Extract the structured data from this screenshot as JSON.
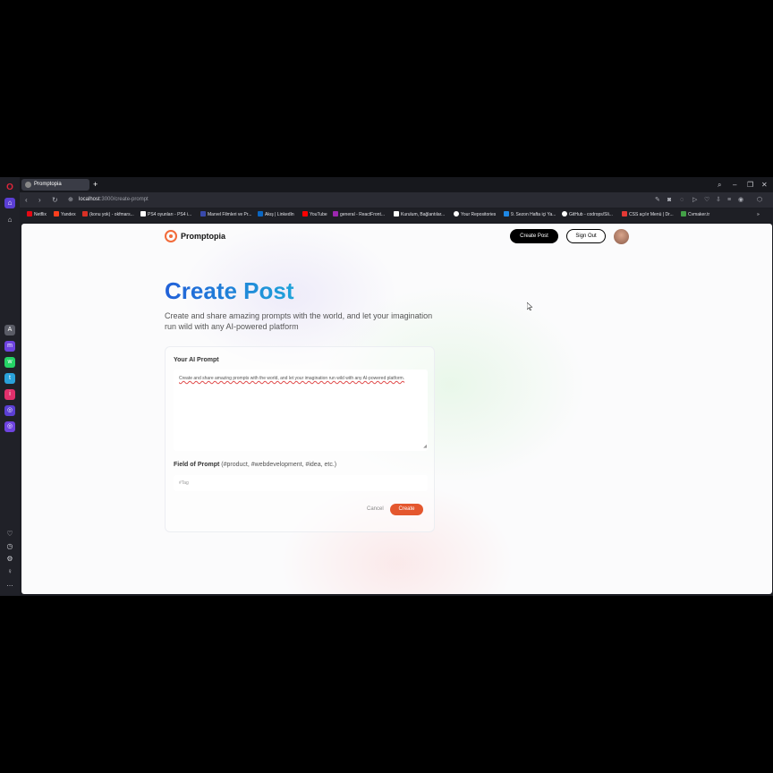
{
  "browser": {
    "tab_title": "Promptopia",
    "new_tab": "+",
    "url_host": "localhost",
    "url_path": ":3000/create-prompt",
    "bookmarks": [
      {
        "label": "Netflix",
        "color": "#e50914"
      },
      {
        "label": "Yandex",
        "color": "#fc3f1d"
      },
      {
        "label": "(konu yok) - okfmars...",
        "color": "#d93025"
      },
      {
        "label": "PS4 oyunları - PS4 i...",
        "color": "#ffffff"
      },
      {
        "label": "Marvel Filmleri ve Pr...",
        "color": "#3949ab"
      },
      {
        "label": "Akış | LinkedIn",
        "color": "#0a66c2"
      },
      {
        "label": "YouTube",
        "color": "#ff0000"
      },
      {
        "label": "general - ReactFront...",
        "color": "#9c27b0"
      },
      {
        "label": "Kurulum, Bağlantılar...",
        "color": "#ffffff"
      },
      {
        "label": "Your Repositories",
        "color": "#ffffff"
      },
      {
        "label": "9. Sezon Hafta içi Ya...",
        "color": "#1e88e5"
      },
      {
        "label": "GitHub - codrops/Sli...",
        "color": "#ffffff"
      },
      {
        "label": "CSS açılır Menü | Dr...",
        "color": "#e53935"
      },
      {
        "label": "Cvmaker.tr",
        "color": "#43a047"
      }
    ]
  },
  "app": {
    "brand": "Promptopia",
    "create_post_button": "Create Post",
    "sign_out_button": "Sign Out",
    "heading": "Create Post",
    "description": "Create and share amazing prompts with the world, and let your imagination run wild with any AI-powered platform",
    "prompt_label": "Your AI Prompt",
    "prompt_value": "Create and share amazing prompts with the world, and let your imagination run wild with any AI-powered platform.",
    "tag_label": "Field of Prompt",
    "tag_hint": "(#product, #webdevelopment, #idea, etc.)",
    "tag_placeholder": "#Tag",
    "cancel": "Cancel",
    "create": "Create"
  }
}
